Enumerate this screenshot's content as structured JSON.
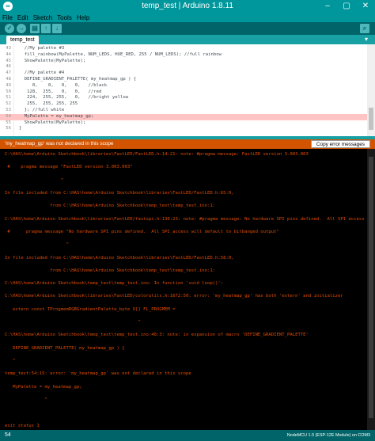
{
  "window": {
    "title": "temp_test | Arduino 1.8.11",
    "minimize": "–",
    "maximize": "▢",
    "close": "✕"
  },
  "menu": [
    "File",
    "Edit",
    "Sketch",
    "Tools",
    "Help"
  ],
  "toolbar": {
    "verify_icon": "✓",
    "upload_icon": "→",
    "new_icon": "▤",
    "open_icon": "↑",
    "save_icon": "↓",
    "serial_icon": "⌕"
  },
  "tabs": {
    "active": "temp_test",
    "menu_icon": "▾"
  },
  "editor": {
    "lines": [
      {
        "n": "43",
        "code": "  //My palette #3"
      },
      {
        "n": "44",
        "code": "  fill_rainbow(MyPalette, NUM_LEDS, HUE_RED, 255 / NUM_LEDS); //full rainbow"
      },
      {
        "n": "45",
        "code": "  ShowPalette(MyPalette);"
      },
      {
        "n": "46",
        "code": ""
      },
      {
        "n": "47",
        "code": "  //My palette #4"
      },
      {
        "n": "48",
        "code": "  DEFINE_GRADIENT_PALETTE( my_heatmap_gp ) {"
      },
      {
        "n": "49",
        "code": "     0,    0,   0,   0,   //black"
      },
      {
        "n": "50",
        "code": "   128,  255,   0,   0,   //red"
      },
      {
        "n": "51",
        "code": "   224,  255, 255,   0,   //bright yellow"
      },
      {
        "n": "52",
        "code": "   255,  255, 255, 255"
      },
      {
        "n": "53",
        "code": "  }; //full white"
      },
      {
        "n": "54",
        "code": "  MyPalette = my_heatmap_gp;"
      },
      {
        "n": "55",
        "code": "  ShowPalette(MyPalette);"
      },
      {
        "n": "56",
        "code": "}"
      }
    ]
  },
  "error_bar": {
    "message": "'my_heatmap_gp' was not declared in this scope",
    "copy_button": "Copy error messages"
  },
  "console": {
    "lines": [
      "C:\\HAS\\home\\Arduino Sketchbook\\libraries\\FastLED/FastLED.h:14:21: note: #pragma message: FastLED version 3.003.003",
      "",
      " #    pragma message \"FastLED version 3.003.003\"",
      "",
      "                     ^",
      "",
      "In file included from C:\\HAS\\home\\Arduino Sketchbook\\libraries\\FastLED/FastLED.h:65:0,",
      "",
      "                 from C:\\HAS\\home\\Arduino Sketchbook\\temp_test\\temp_test.ino:1:",
      "",
      "C:\\HAS\\home\\Arduino Sketchbook\\libraries\\FastLED/fastspi.h:130:23: note: #pragma message: No hardware SPI pins defined.  All SPI access",
      "",
      " #      pragma message \"No hardware SPI pins defined.  All SPI access will default to bitbanged output\"",
      "",
      "                       ^",
      "",
      "In file included from C:\\HAS\\home\\Arduino Sketchbook\\libraries\\FastLED/FastLED.h:58:0,",
      "",
      "                 from C:\\HAS\\home\\Arduino Sketchbook\\temp_test\\temp_test.ino:1:",
      "",
      "C:\\HAS\\home\\Arduino Sketchbook\\temp_test\\temp_test.ino: In function 'void loop()':",
      "",
      "C:\\HAS\\home\\Arduino Sketchbook\\libraries\\FastLED/colorutils.h:1672:50: error: 'my_heatmap_gp' has both 'extern' and initializer",
      "",
      "   extern const TProgmemRGBGradientPalette_byte X[] FL_PROGMEM =",
      "",
      "                                                  ^",
      "",
      "C:\\HAS\\home\\Arduino Sketchbook\\temp_test\\temp_test.ino:48:3: note: in expansion of macro 'DEFINE_GRADIENT_PALETTE'",
      "",
      "   DEFINE_GRADIENT_PALETTE( my_heatmap_gp ) {",
      "",
      "   ^",
      "",
      "temp_test:54:15: error: 'my_heatmap_gp' was not declared in this scope",
      "",
      "   MyPalette = my_heatmap_gp;",
      "",
      "               ^",
      "",
      "",
      "",
      "exit status 1",
      "'my_heatmap_gp' was not declared in this scope"
    ]
  },
  "status_bar": {
    "line_number": "54",
    "board": "NodeMCU 1.0 (ESP-12E Module) on COM3"
  },
  "colors": {
    "teal": "#00979c",
    "dark_teal": "#006468",
    "error_orange": "#d35400",
    "console_text": "#e34c00",
    "error_line_highlight": "#ffc4c4"
  }
}
